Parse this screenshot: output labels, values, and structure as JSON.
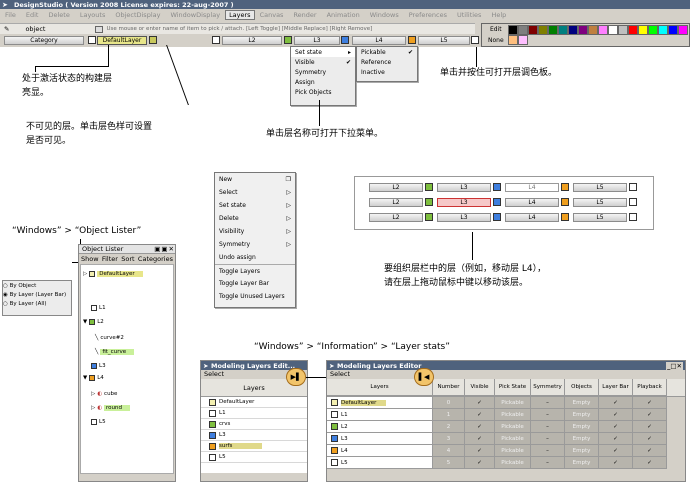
{
  "app_title": "DesignStudio ( Version 2008 License expires: 22-aug-2007 )",
  "menu": [
    "File",
    "Edit",
    "Delete",
    "Layouts",
    "ObjectDisplay",
    "WindowDisplay",
    "Layers",
    "Canvas",
    "Render",
    "Animation",
    "Windows",
    "Preferences",
    "Utilities",
    "Help"
  ],
  "pick_field": "object",
  "command_hint": "Use mouse or enter name of item to pick / attach. [Left Toggle] [Middle Replace] [Right Remove]",
  "layer_bar": {
    "category": "Category",
    "default_layer": "DefaultLayer",
    "layers": [
      "L2",
      "L3",
      "L4",
      "L5"
    ]
  },
  "palette_labels": [
    "Edit",
    "None"
  ],
  "palette_colors": [
    "#000000",
    "#7f7f7f",
    "#7f0000",
    "#7f7f00",
    "#007f00",
    "#007f7f",
    "#00007f",
    "#7f007f",
    "#bf7f3f",
    "#ff7fff",
    "#ffffff",
    "#bfbfbf",
    "#ff0000",
    "#ffff00",
    "#00ff00",
    "#00ffff",
    "#0000ff",
    "#ff00ff",
    "#ffbf7f",
    "#ffbfff"
  ],
  "set_state_menu": {
    "items": [
      "Set state",
      "Visible",
      "Symmetry",
      "Assign",
      "Pick Objects"
    ],
    "sub": [
      "Pickable",
      "Reference",
      "Inactive"
    ]
  },
  "context_menu": [
    "New",
    "Select",
    "Set state",
    "Delete",
    "Visibility",
    "Symmetry",
    "Undo assign",
    "Toggle Layers",
    "Toggle Layer Bar",
    "Toggle Unused Layers"
  ],
  "callouts": {
    "active_layer": "处于激活状态的构建层\n亮显。",
    "invisible_layer": "不可见的层。单击层色样可设置\n是否可见。",
    "click_name": "单击层名称可打开下拉菜单。",
    "palette": "单击并按住可打开层调色板。",
    "reorder": "要组织层栏中的层（例如，移动层 L4），\n请在层上拖动鼠标中键以移动该层。",
    "object_lister_path": "“Windows” > “Object Lister”",
    "layer_stats_path": "“Windows” > “Information” > “Layer stats”"
  },
  "reorder_demo": {
    "row1": [
      "L2",
      "L3",
      "L4",
      "L5"
    ],
    "row2": [
      "L2",
      "L3",
      "L4",
      "L5"
    ],
    "row3": [
      "L2",
      "L3",
      "L4",
      "L5"
    ]
  },
  "object_lister": {
    "title": "Object Lister",
    "menu": [
      "Show",
      "Filter",
      "Sort",
      "Categories"
    ],
    "radio": [
      "By Object",
      "By Layer (Layer Bar)",
      "By Layer (All)"
    ],
    "tree": [
      "DefaultLayer",
      "L1",
      "L2",
      "curve#2",
      "fit_curve",
      "L3",
      "L4",
      "cube",
      "round",
      "L5"
    ]
  },
  "mle_small": {
    "title": "Modeling Layers Edit...",
    "menu": "Select",
    "header": "Layers",
    "layers": [
      "DefaultLayer",
      "L1",
      "crvs",
      "L3",
      "surfs",
      "L5"
    ]
  },
  "mle_big": {
    "title": "Modeling Layers Editor",
    "menu": "Select",
    "headers": [
      "Layers",
      "Number",
      "Visible",
      "Pick State",
      "Symmetry",
      "Objects",
      "Layer Bar",
      "Playback"
    ],
    "rows": [
      [
        "DefaultLayer",
        "0",
        "✓",
        "Pickable",
        "–",
        "Empty",
        "✓",
        "✓"
      ],
      [
        "L1",
        "1",
        "✓",
        "Pickable",
        "–",
        "Empty",
        "✓",
        "✓"
      ],
      [
        "L2",
        "2",
        "✓",
        "Pickable",
        "–",
        "Empty",
        "✓",
        "✓"
      ],
      [
        "L3",
        "3",
        "✓",
        "Pickable",
        "–",
        "Empty",
        "✓",
        "✓"
      ],
      [
        "L4",
        "4",
        "✓",
        "Pickable",
        "–",
        "Empty",
        "✓",
        "✓"
      ],
      [
        "L5",
        "5",
        "✓",
        "Pickable",
        "–",
        "Empty",
        "✓",
        "✓"
      ]
    ]
  },
  "colors": {
    "accent_yellow": "#e5e08a",
    "title_blue": "#4f627d",
    "highlight_orange": "#f2c46a"
  }
}
